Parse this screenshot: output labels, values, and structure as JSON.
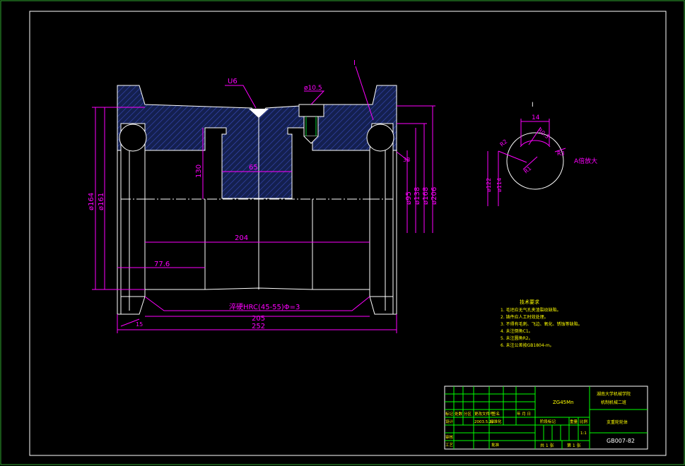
{
  "colors": {
    "background": "#000000",
    "border": "#00ff00",
    "geometry": "#ffffff",
    "dimension": "#ff00ff",
    "section_hatch": "#2a3a9a",
    "notes": "#ffff00",
    "title_block_grid": "#00ff00",
    "title_block_text": "#ffff00"
  },
  "main_view": {
    "surface_mark": "U6",
    "detail_ref": "I",
    "hole_dim": "ø10.5",
    "dims": {
      "d_164": "ø164",
      "d_161": "ø161",
      "len_130": "130",
      "len_65": "65",
      "len_204": "204",
      "len_776": "77.6",
      "len_205": "205",
      "len_252": "252",
      "ang_15": "15",
      "d_95": "ø95",
      "d_138": "ø138",
      "d_168": "ø168",
      "d_206": "ø206",
      "r_38": "38"
    },
    "hardness_note": "淬硬HRC(45-55)Φ=3"
  },
  "detail_view": {
    "label": "I",
    "dim_14": "14",
    "dim_r03": "R0.3",
    "dim_r02": "R2",
    "dim_r1": "R1",
    "dim_r3": "R3",
    "dim_d122": "ø122",
    "dim_d114": "ø114",
    "scale_note": "A倍放大"
  },
  "notes": {
    "title": "技术要求",
    "lines": [
      "1. 毛坯应无气孔夹渣裂纹缺陷。",
      "2. 铸件应人工时效处理。",
      "3. 不得有毛刺、飞边、氧化、锈蚀等缺陷。",
      "4. 未注倒角C1。",
      "5. 未注圆角R2。",
      "6. 未注公差按GB1804-m。"
    ]
  },
  "title_block": {
    "material": "ZG45Mn",
    "school": "湖南大学机械学院",
    "drawing_class": "机制机械二班",
    "part_name": "支重轮轮体",
    "drawing_no": "GB007-82",
    "scale": "1:1",
    "sheet_total": "共 1 张",
    "sheet_no": "第 1 张",
    "date": "2003.5.22",
    "designer_label": "设计",
    "standard_label": "标准化",
    "approve_label": "批准",
    "process_label": "工艺",
    "check_label": "审核",
    "stage_label": "阶段标记",
    "weight_label": "重量",
    "scale_label": "比例",
    "mark_label": "标记",
    "count_label": "处数",
    "zone_label": "分区",
    "change_label": "更改文件号",
    "sign_label": "签名",
    "ymd_label": "年 月 日"
  }
}
